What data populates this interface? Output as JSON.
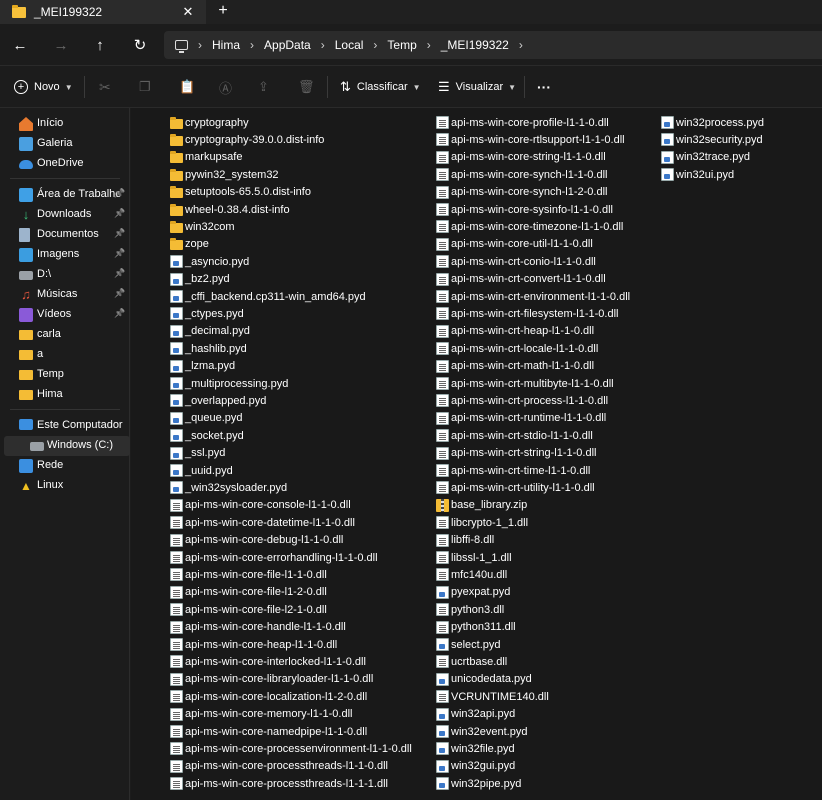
{
  "tab": {
    "title": "_MEI199322",
    "close": "✕",
    "new": "+"
  },
  "nav": {
    "back": "←",
    "forward": "→",
    "up": "↑",
    "refresh": "↻"
  },
  "breadcrumb": [
    "Hima",
    "AppData",
    "Local",
    "Temp",
    "_MEI199322"
  ],
  "toolbar": {
    "new_label": "Novo",
    "sort_label": "Classificar",
    "view_label": "Visualizar",
    "more_label": "···"
  },
  "sidebar": {
    "quick": [
      {
        "label": "Início",
        "icon": "home-icon"
      },
      {
        "label": "Galeria",
        "icon": "gallery-icon"
      },
      {
        "label": "OneDrive",
        "icon": "cloud-icon"
      }
    ],
    "pinned": [
      {
        "label": "Área de Trabalho",
        "icon": "desktop-icon",
        "pinned": true
      },
      {
        "label": "Downloads",
        "icon": "download-icon",
        "pinned": true
      },
      {
        "label": "Documentos",
        "icon": "documents-icon",
        "pinned": true
      },
      {
        "label": "Imagens",
        "icon": "pictures-icon",
        "pinned": true
      },
      {
        "label": "D:\\",
        "icon": "drive-icon",
        "pinned": true
      },
      {
        "label": "Músicas",
        "icon": "music-icon",
        "pinned": true
      },
      {
        "label": "Vídeos",
        "icon": "videos-icon",
        "pinned": true
      },
      {
        "label": "carla",
        "icon": "folder-icon",
        "pinned": false
      },
      {
        "label": "a",
        "icon": "folder-icon",
        "pinned": false
      },
      {
        "label": "Temp",
        "icon": "folder-icon",
        "pinned": false
      },
      {
        "label": "Hima",
        "icon": "folder-icon",
        "pinned": false
      }
    ],
    "devices": [
      {
        "label": "Este Computador",
        "icon": "computer-icon"
      },
      {
        "label": "Windows (C:)",
        "icon": "drive-icon",
        "selected": true
      },
      {
        "label": "Rede",
        "icon": "network-icon"
      },
      {
        "label": "Linux",
        "icon": "linux-icon"
      }
    ]
  },
  "files": {
    "col1": [
      {
        "name": "cryptography",
        "type": "folder"
      },
      {
        "name": "cryptography-39.0.0.dist-info",
        "type": "folder"
      },
      {
        "name": "markupsafe",
        "type": "folder"
      },
      {
        "name": "pywin32_system32",
        "type": "folder"
      },
      {
        "name": "setuptools-65.5.0.dist-info",
        "type": "folder"
      },
      {
        "name": "wheel-0.38.4.dist-info",
        "type": "folder"
      },
      {
        "name": "win32com",
        "type": "folder"
      },
      {
        "name": "zope",
        "type": "folder"
      },
      {
        "name": "_asyncio.pyd",
        "type": "pyd"
      },
      {
        "name": "_bz2.pyd",
        "type": "pyd"
      },
      {
        "name": "_cffi_backend.cp311-win_amd64.pyd",
        "type": "pyd"
      },
      {
        "name": "_ctypes.pyd",
        "type": "pyd"
      },
      {
        "name": "_decimal.pyd",
        "type": "pyd"
      },
      {
        "name": "_hashlib.pyd",
        "type": "pyd"
      },
      {
        "name": "_lzma.pyd",
        "type": "pyd"
      },
      {
        "name": "_multiprocessing.pyd",
        "type": "pyd"
      },
      {
        "name": "_overlapped.pyd",
        "type": "pyd"
      },
      {
        "name": "_queue.pyd",
        "type": "pyd"
      },
      {
        "name": "_socket.pyd",
        "type": "pyd"
      },
      {
        "name": "_ssl.pyd",
        "type": "pyd"
      },
      {
        "name": "_uuid.pyd",
        "type": "pyd"
      },
      {
        "name": "_win32sysloader.pyd",
        "type": "pyd"
      },
      {
        "name": "api-ms-win-core-console-l1-1-0.dll",
        "type": "dll"
      },
      {
        "name": "api-ms-win-core-datetime-l1-1-0.dll",
        "type": "dll"
      },
      {
        "name": "api-ms-win-core-debug-l1-1-0.dll",
        "type": "dll"
      },
      {
        "name": "api-ms-win-core-errorhandling-l1-1-0.dll",
        "type": "dll"
      },
      {
        "name": "api-ms-win-core-file-l1-1-0.dll",
        "type": "dll"
      },
      {
        "name": "api-ms-win-core-file-l1-2-0.dll",
        "type": "dll"
      },
      {
        "name": "api-ms-win-core-file-l2-1-0.dll",
        "type": "dll"
      },
      {
        "name": "api-ms-win-core-handle-l1-1-0.dll",
        "type": "dll"
      },
      {
        "name": "api-ms-win-core-heap-l1-1-0.dll",
        "type": "dll"
      },
      {
        "name": "api-ms-win-core-interlocked-l1-1-0.dll",
        "type": "dll"
      },
      {
        "name": "api-ms-win-core-libraryloader-l1-1-0.dll",
        "type": "dll"
      },
      {
        "name": "api-ms-win-core-localization-l1-2-0.dll",
        "type": "dll"
      },
      {
        "name": "api-ms-win-core-memory-l1-1-0.dll",
        "type": "dll"
      },
      {
        "name": "api-ms-win-core-namedpipe-l1-1-0.dll",
        "type": "dll"
      },
      {
        "name": "api-ms-win-core-processenvironment-l1-1-0.dll",
        "type": "dll"
      },
      {
        "name": "api-ms-win-core-processthreads-l1-1-0.dll",
        "type": "dll"
      },
      {
        "name": "api-ms-win-core-processthreads-l1-1-1.dll",
        "type": "dll"
      }
    ],
    "col2": [
      {
        "name": "api-ms-win-core-profile-l1-1-0.dll",
        "type": "dll"
      },
      {
        "name": "api-ms-win-core-rtlsupport-l1-1-0.dll",
        "type": "dll"
      },
      {
        "name": "api-ms-win-core-string-l1-1-0.dll",
        "type": "dll"
      },
      {
        "name": "api-ms-win-core-synch-l1-1-0.dll",
        "type": "dll"
      },
      {
        "name": "api-ms-win-core-synch-l1-2-0.dll",
        "type": "dll"
      },
      {
        "name": "api-ms-win-core-sysinfo-l1-1-0.dll",
        "type": "dll"
      },
      {
        "name": "api-ms-win-core-timezone-l1-1-0.dll",
        "type": "dll"
      },
      {
        "name": "api-ms-win-core-util-l1-1-0.dll",
        "type": "dll"
      },
      {
        "name": "api-ms-win-crt-conio-l1-1-0.dll",
        "type": "dll"
      },
      {
        "name": "api-ms-win-crt-convert-l1-1-0.dll",
        "type": "dll"
      },
      {
        "name": "api-ms-win-crt-environment-l1-1-0.dll",
        "type": "dll"
      },
      {
        "name": "api-ms-win-crt-filesystem-l1-1-0.dll",
        "type": "dll"
      },
      {
        "name": "api-ms-win-crt-heap-l1-1-0.dll",
        "type": "dll"
      },
      {
        "name": "api-ms-win-crt-locale-l1-1-0.dll",
        "type": "dll"
      },
      {
        "name": "api-ms-win-crt-math-l1-1-0.dll",
        "type": "dll"
      },
      {
        "name": "api-ms-win-crt-multibyte-l1-1-0.dll",
        "type": "dll"
      },
      {
        "name": "api-ms-win-crt-process-l1-1-0.dll",
        "type": "dll"
      },
      {
        "name": "api-ms-win-crt-runtime-l1-1-0.dll",
        "type": "dll"
      },
      {
        "name": "api-ms-win-crt-stdio-l1-1-0.dll",
        "type": "dll"
      },
      {
        "name": "api-ms-win-crt-string-l1-1-0.dll",
        "type": "dll"
      },
      {
        "name": "api-ms-win-crt-time-l1-1-0.dll",
        "type": "dll"
      },
      {
        "name": "api-ms-win-crt-utility-l1-1-0.dll",
        "type": "dll"
      },
      {
        "name": "base_library.zip",
        "type": "zip"
      },
      {
        "name": "libcrypto-1_1.dll",
        "type": "dll"
      },
      {
        "name": "libffi-8.dll",
        "type": "dll"
      },
      {
        "name": "libssl-1_1.dll",
        "type": "dll"
      },
      {
        "name": "mfc140u.dll",
        "type": "dll"
      },
      {
        "name": "pyexpat.pyd",
        "type": "pyd"
      },
      {
        "name": "python3.dll",
        "type": "dll"
      },
      {
        "name": "python311.dll",
        "type": "dll"
      },
      {
        "name": "select.pyd",
        "type": "pyd"
      },
      {
        "name": "ucrtbase.dll",
        "type": "dll"
      },
      {
        "name": "unicodedata.pyd",
        "type": "pyd"
      },
      {
        "name": "VCRUNTIME140.dll",
        "type": "dll"
      },
      {
        "name": "win32api.pyd",
        "type": "pyd"
      },
      {
        "name": "win32event.pyd",
        "type": "pyd"
      },
      {
        "name": "win32file.pyd",
        "type": "pyd"
      },
      {
        "name": "win32gui.pyd",
        "type": "pyd"
      },
      {
        "name": "win32pipe.pyd",
        "type": "pyd"
      }
    ],
    "col3": [
      {
        "name": "win32process.pyd",
        "type": "pyd"
      },
      {
        "name": "win32security.pyd",
        "type": "pyd"
      },
      {
        "name": "win32trace.pyd",
        "type": "pyd"
      },
      {
        "name": "win32ui.pyd",
        "type": "pyd"
      }
    ]
  }
}
